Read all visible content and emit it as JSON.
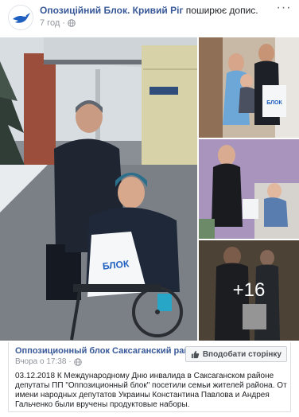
{
  "header": {
    "page_name": "Опозиційний Блок. Кривий Ріг",
    "shared_text": "поширює допис.",
    "time": "7 год",
    "more_label": "···"
  },
  "photos": {
    "more_count": "+16"
  },
  "shared_post": {
    "page_name": "Оппозиционный блок Саксаганский район",
    "time": "Вчора о 17:38",
    "like_button_label": "Вподобати сторінку",
    "text": "03.12.2018 К Международному Дню инвалида в Саксаганском районе депутаты ПП \"Оппозиционный блок\" посетили семьи жителей района. От имени народных депутатов Украины Константина Павлова и Андрея Гальченко были вручены продуктовые наборы."
  },
  "colors": {
    "link": "#385898",
    "meta": "#90949c",
    "brand_blue": "#1f5fbf"
  },
  "icons": {
    "avatar": "bird-logo-icon",
    "privacy": "globe-icon",
    "like": "thumb-up-icon"
  }
}
